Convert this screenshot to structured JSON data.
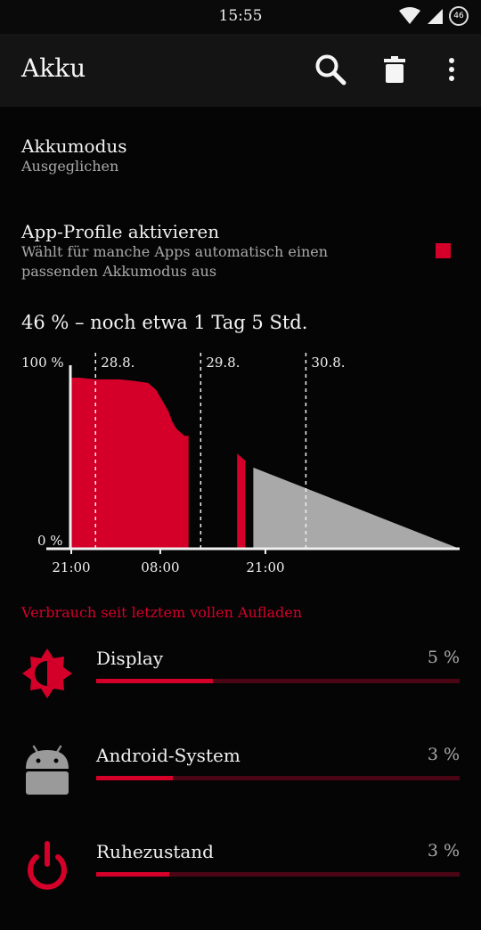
{
  "status_bar": {
    "time": "15:55",
    "battery_level": "46",
    "icons": [
      "wifi-icon",
      "signal-icon",
      "battery-icon"
    ]
  },
  "toolbar": {
    "title": "Akku",
    "icons": [
      "search-icon",
      "trash-icon",
      "more-vert-icon"
    ]
  },
  "settings": [
    {
      "title": "Akkumodus",
      "subtitle": "Ausgeglichen"
    },
    {
      "title": "App-Profile aktivieren",
      "subtitle": "Wählt für manche Apps automatisch einen passenden Akkumodus aus",
      "checked": true
    }
  ],
  "summary": "46 % – noch etwa 1 Tag 5 Std.",
  "chart_data": {
    "type": "area",
    "ylabel_top": "100 %",
    "ylabel_bottom": "0 %",
    "ylim": [
      0,
      100
    ],
    "xlim_hours": [
      0,
      48
    ],
    "x_tick_labels": [
      {
        "label": "21:00",
        "hour": 0
      },
      {
        "label": "08:00",
        "hour": 11
      },
      {
        "label": "21:00",
        "hour": 24
      }
    ],
    "day_markers": [
      {
        "label": "28.8.",
        "hour": 3
      },
      {
        "label": "29.8.",
        "hour": 16
      },
      {
        "label": "30.8.",
        "hour": 29
      }
    ],
    "series": [
      {
        "values": [
          [
            0,
            97
          ],
          [
            1,
            97
          ],
          [
            3,
            96
          ],
          [
            6,
            96
          ],
          [
            8,
            95
          ],
          [
            9.5,
            94
          ],
          [
            10,
            92
          ],
          [
            10.5,
            90
          ],
          [
            11,
            86
          ],
          [
            11.5,
            82
          ],
          [
            12,
            78
          ],
          [
            12.5,
            72
          ],
          [
            13,
            68
          ],
          [
            14,
            64
          ],
          [
            14.5,
            64
          ],
          [
            14.5,
            0
          ]
        ]
      },
      {
        "values": [
          [
            20.5,
            54
          ],
          [
            21.5,
            50
          ],
          [
            21.5,
            0
          ]
        ]
      },
      {
        "values": [
          [
            22.5,
            46
          ],
          [
            48,
            0
          ]
        ],
        "estimated": true
      }
    ],
    "colors": {
      "measured": "#d4002a",
      "estimate": "#a9a9a9"
    },
    "grid": false
  },
  "usage": {
    "header": "Verbrauch seit letztem vollen Aufladen",
    "items": [
      {
        "name": "Display",
        "percent": "5 %",
        "bar_fraction": 0.32,
        "icon": "brightness-icon"
      },
      {
        "name": "Android-System",
        "percent": "3 %",
        "bar_fraction": 0.21,
        "icon": "android-icon"
      },
      {
        "name": "Ruhezustand",
        "percent": "3 %",
        "bar_fraction": 0.2,
        "icon": "power-icon"
      }
    ]
  },
  "colors": {
    "accent": "#d4002a",
    "accent_dark": "#4a0614",
    "background": "#050505",
    "toolbar": "#141414"
  }
}
